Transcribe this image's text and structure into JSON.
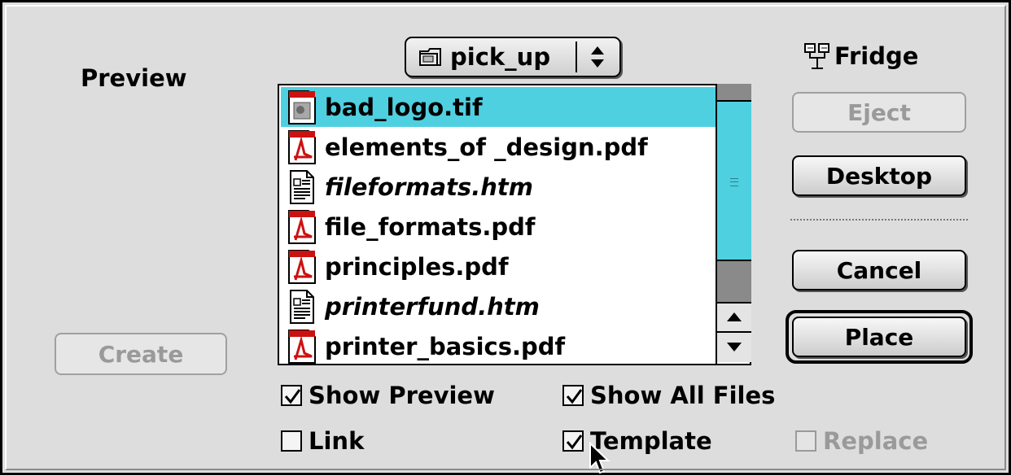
{
  "dialog": {
    "preview_label": "Preview",
    "folder_popup": {
      "name": "pick_up",
      "icon": "folder-icon"
    },
    "volume": {
      "name": "Fridge",
      "icon": "network-volume-icon"
    },
    "files": [
      {
        "name": "bad_logo.tif",
        "icon": "tiff-document-icon",
        "italic": false,
        "selected": true
      },
      {
        "name": "elements_of _design.pdf",
        "icon": "pdf-document-icon",
        "italic": false,
        "selected": false
      },
      {
        "name": "fileformats.htm",
        "icon": "text-document-icon",
        "italic": true,
        "selected": false
      },
      {
        "name": "file_formats.pdf",
        "icon": "pdf-document-icon",
        "italic": false,
        "selected": false
      },
      {
        "name": "principles.pdf",
        "icon": "pdf-document-icon",
        "italic": false,
        "selected": false
      },
      {
        "name": "printerfund.htm",
        "icon": "text-document-icon",
        "italic": true,
        "selected": false
      },
      {
        "name": "printer_basics.pdf",
        "icon": "pdf-document-icon",
        "italic": false,
        "selected": false
      }
    ],
    "buttons": {
      "eject": "Eject",
      "desktop": "Desktop",
      "cancel": "Cancel",
      "place": "Place",
      "create": "Create"
    },
    "checkboxes": {
      "show_preview": {
        "label": "Show Preview",
        "checked": true
      },
      "show_all_files": {
        "label": "Show All Files",
        "checked": true
      },
      "link": {
        "label": "Link",
        "checked": false
      },
      "template": {
        "label": "Template",
        "checked": true
      },
      "replace": {
        "label": "Replace",
        "checked": false,
        "disabled": true
      }
    },
    "colors": {
      "selection": "#4fd0e0",
      "pdf_red": "#cc1111",
      "dialog_bg": "#dddddd"
    }
  }
}
